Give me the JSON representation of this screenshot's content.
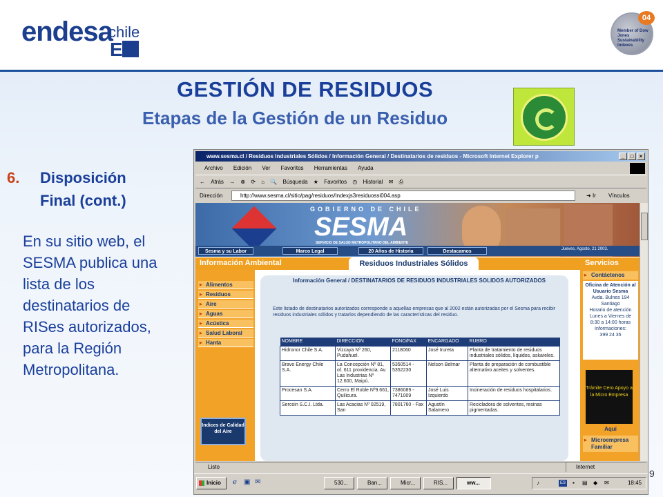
{
  "slide": {
    "title": "GESTIÓN DE RESIDUOS",
    "subtitle": "Etapas de la Gestión de un Residuo",
    "section_number": "6.",
    "section_title_line1": "Disposición",
    "section_title_line2": "Final (cont.)",
    "body_lines": [
      "En su sitio web, el",
      "SESMA publica una",
      "lista de los",
      "destinatarios de",
      "RISes autorizados,",
      "para la Región",
      "Metropolitana."
    ],
    "page_number": "9",
    "logo": {
      "brand": "endesa",
      "country": "chile",
      "mark": "E"
    },
    "badge": {
      "year": "04",
      "text": "Member of Dow Jones Sustainability Indexes"
    }
  },
  "browser": {
    "title": "www.sesma.cl / Residuos Industriales Sólidos / Información General / Destinatarios de residuos  - Microsoft Internet Explorer p",
    "menu": [
      "Archivo",
      "Edición",
      "Ver",
      "Favoritos",
      "Herramientas",
      "Ayuda"
    ],
    "toolbar": {
      "back": "Atrás",
      "search": "Búsqueda",
      "favorites": "Favoritos",
      "history": "Historial"
    },
    "address_label": "Dirección",
    "address": "http://www.sesma.cl/sitio/pag/residuos/Indexjs3residuossi004.asp",
    "go_label": "Ir",
    "links_label": "Vínculos",
    "status_left": "Listo",
    "status_right": "Internet"
  },
  "site": {
    "gobierno": "GOBIERNO DE CHILE",
    "name": "SESMA",
    "tagline": "SERVICIO DE SALUD METROPOLITANO DEL AMBIENTE",
    "nav": [
      "Sesma y su Labor",
      "Marco Legal",
      "20 Años de Historia",
      "Destacamos"
    ],
    "date": "Jueves, Agosto, 21 2003.",
    "ribbon_left": "Información Ambiental",
    "ribbon_center": "Residuos Industriales Sólidos",
    "ribbon_right": "Servicios",
    "left_menu": [
      "Alimentos",
      "Residuos",
      "Aire",
      "Aguas",
      "Acústica",
      "Salud Laboral",
      "Hanta"
    ],
    "calidad": "Indices de Calidad del Aire",
    "contact_label": "Contáctenos",
    "office_title": "Oficina de Atención al Usuario Sesma",
    "office_lines": [
      "Avda. Bulnes 194",
      "Santiago",
      "Horario de atención",
      "Lunes a Viernes de",
      "8:30 a 14:00 horas",
      "Informaciones:",
      "399 24 35"
    ],
    "tramite": "Trámite Cero Apoyo a la Micro Empresa",
    "aqui": "Aquí",
    "micro": "Microempresa Familiar",
    "heading": "Información General / DESTINATARIOS DE RESIDUOS INDUSTRIALES SOLIDOS AUTORIZADOS",
    "intro": "Este listado de destinatarios autorizados corresponde a aquellas empresas que al 2002 están autorizadas por el Sesma para recibir residuos industriales sólidos y tratarlos dependiendo de las características del residuo.",
    "table": {
      "headers": [
        "NOMBRE",
        "DIRECCION",
        "FONO/FAX",
        "ENCARGADO",
        "RUBRO"
      ],
      "rows": [
        [
          "Hidronor Chile S.A.",
          "Vizcaya Nº 260, Pudahuel.",
          "2118060",
          "José Irureta",
          "Planta de tratamiento de residuos industriales sólidos, líquidos, askareles."
        ],
        [
          "Bravo Energy Chile S.A.",
          "La Concepción Nº 81, of. 611 providencia. Av. Las Industrias Nº 12.600, Maipú.",
          "5350514 - 5352230",
          "Nelson Belmar",
          "Planta de preparación de combustible alternativo aceites y solventes."
        ],
        [
          "Procesan S.A.",
          "Cerro El Roble Nº9.661, Quilicura.",
          "7386089 - 7471009",
          "José Luis Izquierdo",
          "Incineración de residuos hospitalarios."
        ],
        [
          "Sercoin S.C.I. Ltda.",
          "Las Acacias Nº 02519, San",
          "7801760 - Fax",
          "Agustín Salamero",
          "Recicladora de solventes, resinas pigmentadas."
        ]
      ]
    }
  },
  "taskbar": {
    "start": "Inicio",
    "tasks": [
      "530...",
      "Ban...",
      "Micr...",
      "RIS...",
      "ww..."
    ],
    "lang": "ES",
    "time": "18:45"
  }
}
